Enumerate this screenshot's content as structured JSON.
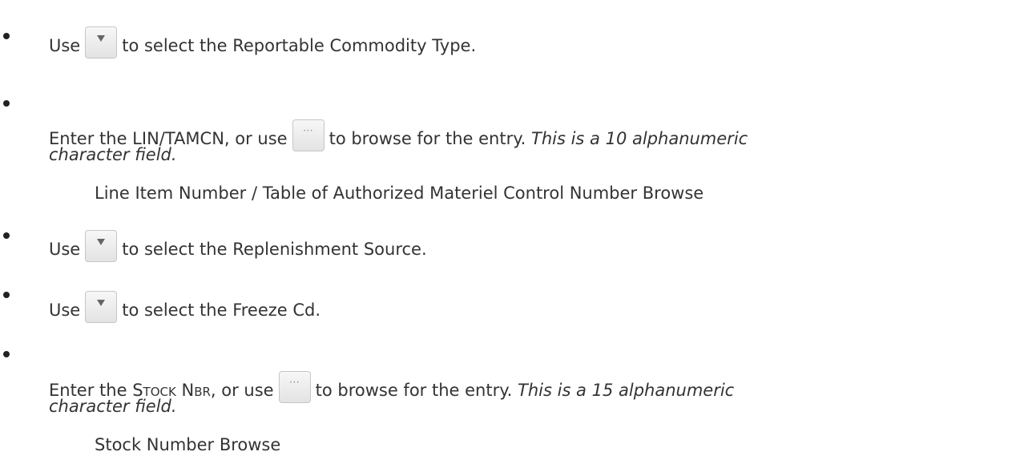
{
  "items": [
    {
      "prefix": "Use",
      "button": "dropdown",
      "suffix": "to select the Reportable Commodity Type."
    },
    {
      "prefix": "Enter the LIN/TAMCN, or use",
      "button": "browse",
      "suffix": "to browse for the entry.",
      "note_line1": "This is a 10 alphanumeric",
      "note_line2": "character field.",
      "caption": "Line Item Number / Table of Authorized Materiel Control Number Browse"
    },
    {
      "prefix": "Use",
      "button": "dropdown",
      "suffix": "to select the Replenishment Source."
    },
    {
      "prefix": "Use",
      "button": "dropdown",
      "suffix": "to select the Freeze Cd."
    },
    {
      "prefix_a": "Enter the",
      "field": "Stock Nbr",
      "prefix_b": ", or use",
      "button": "browse",
      "suffix": "to browse for the entry.",
      "note_line1": "This is a 15 alphanumeric",
      "note_line2": "character field.",
      "caption": "Stock Number Browse"
    }
  ],
  "icons": {
    "dropdown": "dropdown-arrow-icon",
    "browse": "ellipsis-icon",
    "browse_glyph": "···"
  }
}
